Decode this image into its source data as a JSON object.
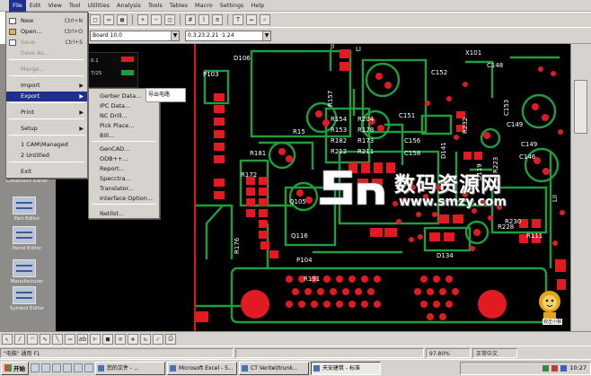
{
  "menubar": {
    "items": [
      "File",
      "Edit",
      "View",
      "Tool",
      "Utilities",
      "Analysis",
      "Tools",
      "Tables",
      "Macro",
      "Settings",
      "Help"
    ]
  },
  "toolbar1": {
    "buttons": [
      "new-icon",
      "open-icon",
      "save-icon",
      "zoom-in-icon",
      "zoom-out-icon",
      "fit-icon",
      "grid-icon",
      "route-icon",
      "layer-icon",
      "text-icon",
      "measure-icon",
      "drc-icon"
    ]
  },
  "toolbar2": {
    "font_combo": "Board 10.0",
    "layer_combo": "0.3.23.2.21 ·1.24"
  },
  "file_menu": {
    "items": [
      {
        "label": "New",
        "shortcut": "Ctrl+N",
        "icon": "new-file-icon",
        "state": "normal"
      },
      {
        "label": "Open...",
        "shortcut": "Ctrl+O",
        "icon": "open-folder-icon",
        "state": "normal"
      },
      {
        "label": "Save",
        "shortcut": "Ctrl+S",
        "icon": "save-icon",
        "state": "disabled"
      },
      {
        "label": "Save As...",
        "shortcut": "",
        "icon": "",
        "state": "disabled"
      },
      {
        "label": "Merge...",
        "shortcut": "",
        "icon": "",
        "state": "disabled"
      },
      {
        "label": "Import",
        "shortcut": "",
        "icon": "",
        "state": "normal",
        "submenu": true
      },
      {
        "label": "Export",
        "shortcut": "",
        "icon": "",
        "state": "highlight",
        "submenu": true
      },
      {
        "label": "Print",
        "shortcut": "",
        "icon": "",
        "state": "normal",
        "submenu": true
      },
      {
        "label": "Setup",
        "shortcut": "",
        "icon": "",
        "state": "normal",
        "submenu": true
      },
      {
        "label": "1 CAM\\Managed",
        "shortcut": "",
        "icon": "",
        "state": "normal"
      },
      {
        "label": "2 Untitled",
        "shortcut": "",
        "icon": "",
        "state": "normal"
      },
      {
        "label": "Exit",
        "shortcut": "",
        "icon": "",
        "state": "normal"
      }
    ]
  },
  "export_menu": {
    "items": [
      "Gerber Data...",
      "IPC Data...",
      "NC Drill...",
      "Pick Place...",
      "Bill...",
      "GenCAD...",
      "ODB++...",
      "Report...",
      "Specctra...",
      "Translator...",
      "Interface Option...",
      "Netlist..."
    ]
  },
  "tooltip": "导出电路",
  "mini_panel": {
    "row1": "0.1",
    "row2": "7/25"
  },
  "palette": {
    "labels": [
      "Constraint Editor",
      "Part Editor",
      "Panel Editor",
      "Manufacturer",
      "Symbol Editor"
    ]
  },
  "pcb": {
    "labels": [
      "P103",
      "D106",
      "R157",
      "R15",
      "C151",
      "C152",
      "C149",
      "C148",
      "X101",
      "R154",
      "R204",
      "R153",
      "R178",
      "R182",
      "R173",
      "R212",
      "R211",
      "D141",
      "R232",
      "C156",
      "C158",
      "R223",
      "R230",
      "C153",
      "C146",
      "C149",
      "R172",
      "R181",
      "Q105",
      "Q116",
      "R176",
      "P104",
      "D134",
      "R228",
      "R111",
      "LI",
      "JI",
      "LII",
      "D119",
      "R191"
    ]
  },
  "watermark": {
    "brand": "数码资源网",
    "url": "www.smzy.com"
  },
  "mascot_label": "双击小狮",
  "statusbar": {
    "left": "\"电脑\" 通用 F1",
    "zoom": "97.80%",
    "mode": "正常中文"
  },
  "taskbar": {
    "start": "开始",
    "tasks": [
      "您的文件 - ...",
      "Microsoft Excel - 5...",
      "CT Veritel/trunk...",
      "天安建筑 - 标准"
    ],
    "active_task": 3,
    "clock": "10:27"
  },
  "colors": {
    "trace": "#1e9e3e",
    "pad": "#e21b23",
    "silkscreen": "#ffffff",
    "board": "#000000",
    "menu_highlight": "#1e2f8e"
  }
}
